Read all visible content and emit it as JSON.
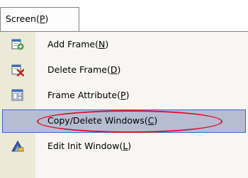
{
  "menu": {
    "title": "Screen",
    "title_key": "P",
    "items": [
      {
        "label": "Add Frame",
        "key": "N",
        "icon": "add-frame-icon",
        "selected": false
      },
      {
        "label": "Delete Frame",
        "key": "D",
        "icon": "delete-frame-icon",
        "selected": false
      },
      {
        "label": "Frame Attribute",
        "key": "P",
        "icon": "frame-attribute-icon",
        "selected": false
      },
      {
        "label": "Copy/Delete Windows",
        "key": "C",
        "icon": "copy-delete-windows-icon",
        "selected": true
      },
      {
        "label": "Edit Init Window",
        "key": "L",
        "icon": "edit-init-window-icon",
        "selected": false
      }
    ]
  },
  "colors": {
    "highlight_fill": "#b6bdd2",
    "highlight_border": "#316ac5",
    "annotation_circle": "#e0102a",
    "icon_gutter": "#ece9d8"
  }
}
